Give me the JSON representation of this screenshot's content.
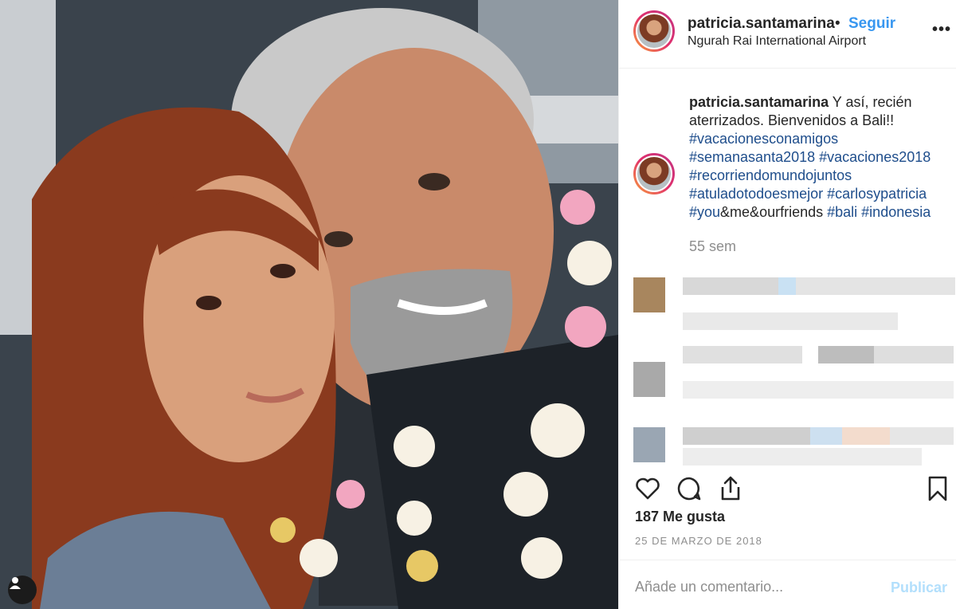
{
  "post": {
    "username": "patricia.santamarina",
    "separator": "•",
    "follow_label": "Seguir",
    "location": "Ngurah Rai International Airport",
    "more_label": "•••",
    "caption": {
      "username": "patricia.santamarina",
      "text": "Y así, recién aterrizados. Bienvenidos a Bali!!",
      "hashtags": [
        "#vacacionesconamigos",
        "#semanasanta2018",
        "#vacaciones2018",
        "#recorriendomundojuntos",
        "#atuladotodoesmejor",
        "#carlosypatricia",
        "#you",
        "&me&ourfriends",
        "#bali",
        "#indonesia"
      ]
    },
    "age": "55 sem",
    "likes": "187 Me gusta",
    "date": "25 DE MARZO DE 2018",
    "comment_placeholder": "Añade un comentario...",
    "publish_label": "Publicar"
  },
  "icons": {
    "heart": "heart-icon",
    "comment": "comment-icon",
    "share": "share-icon",
    "bookmark": "bookmark-icon",
    "tag_people": "user-icon"
  },
  "colors": {
    "link": "#3897f0",
    "hashtag": "#1f4e8c",
    "muted": "#8e8e8e",
    "publish_disabled": "#b2dffc"
  }
}
